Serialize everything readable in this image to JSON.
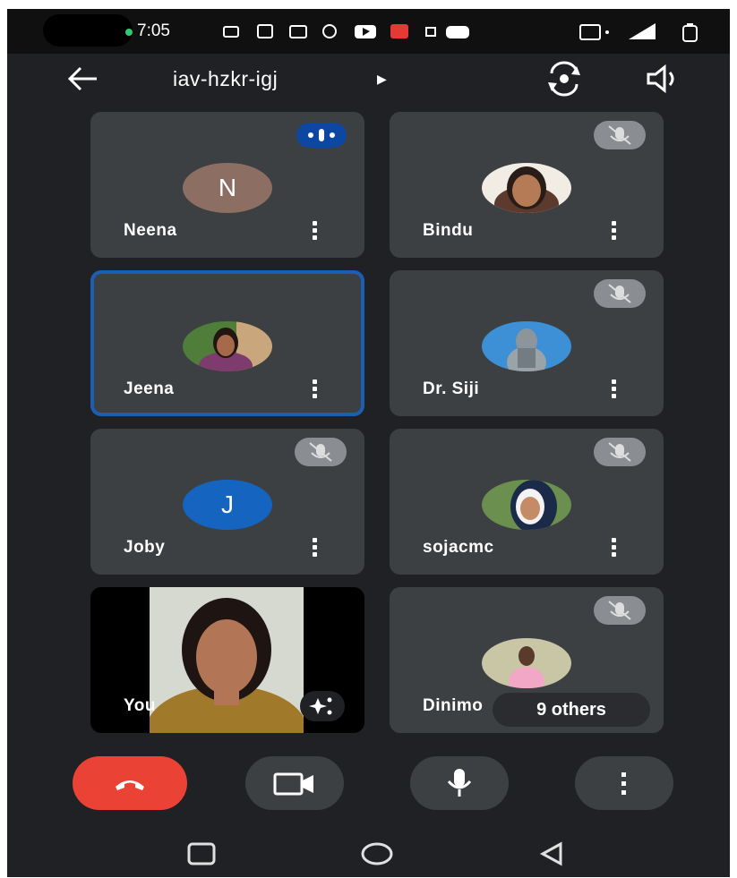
{
  "status_bar": {
    "time": "7:05",
    "status_icons": [
      "notification-icons",
      "wifi-icon",
      "signal-icon",
      "battery-icon"
    ]
  },
  "call": {
    "meeting_code": "iav-hzkr-igj"
  },
  "participants": [
    {
      "name": "Neena",
      "initial": "N",
      "avatar_color": "#8d6e63",
      "speaking": true,
      "muted": false
    },
    {
      "name": "Bindu",
      "photo": true,
      "muted": true
    },
    {
      "name": "Jeena",
      "photo": true,
      "muted": false,
      "highlighted": true
    },
    {
      "name": "Dr. Siji",
      "photo": true,
      "muted": true
    },
    {
      "name": "Joby",
      "initial": "J",
      "avatar_color": "#1565c0",
      "muted": true
    },
    {
      "name": "sojacmc",
      "photo": true,
      "muted": true
    },
    {
      "name": "You",
      "self_view": true
    },
    {
      "name": "Dinimo",
      "photo": true,
      "muted": true
    }
  ],
  "overflow": {
    "label": "9 others"
  },
  "controls": [
    "end-call",
    "camera",
    "microphone",
    "more-options"
  ],
  "colors": {
    "background": "#202124",
    "tile": "#3c4043",
    "end_call": "#ea4335",
    "active_border": "#1a5fb4",
    "speaking": "#0d47a1"
  }
}
